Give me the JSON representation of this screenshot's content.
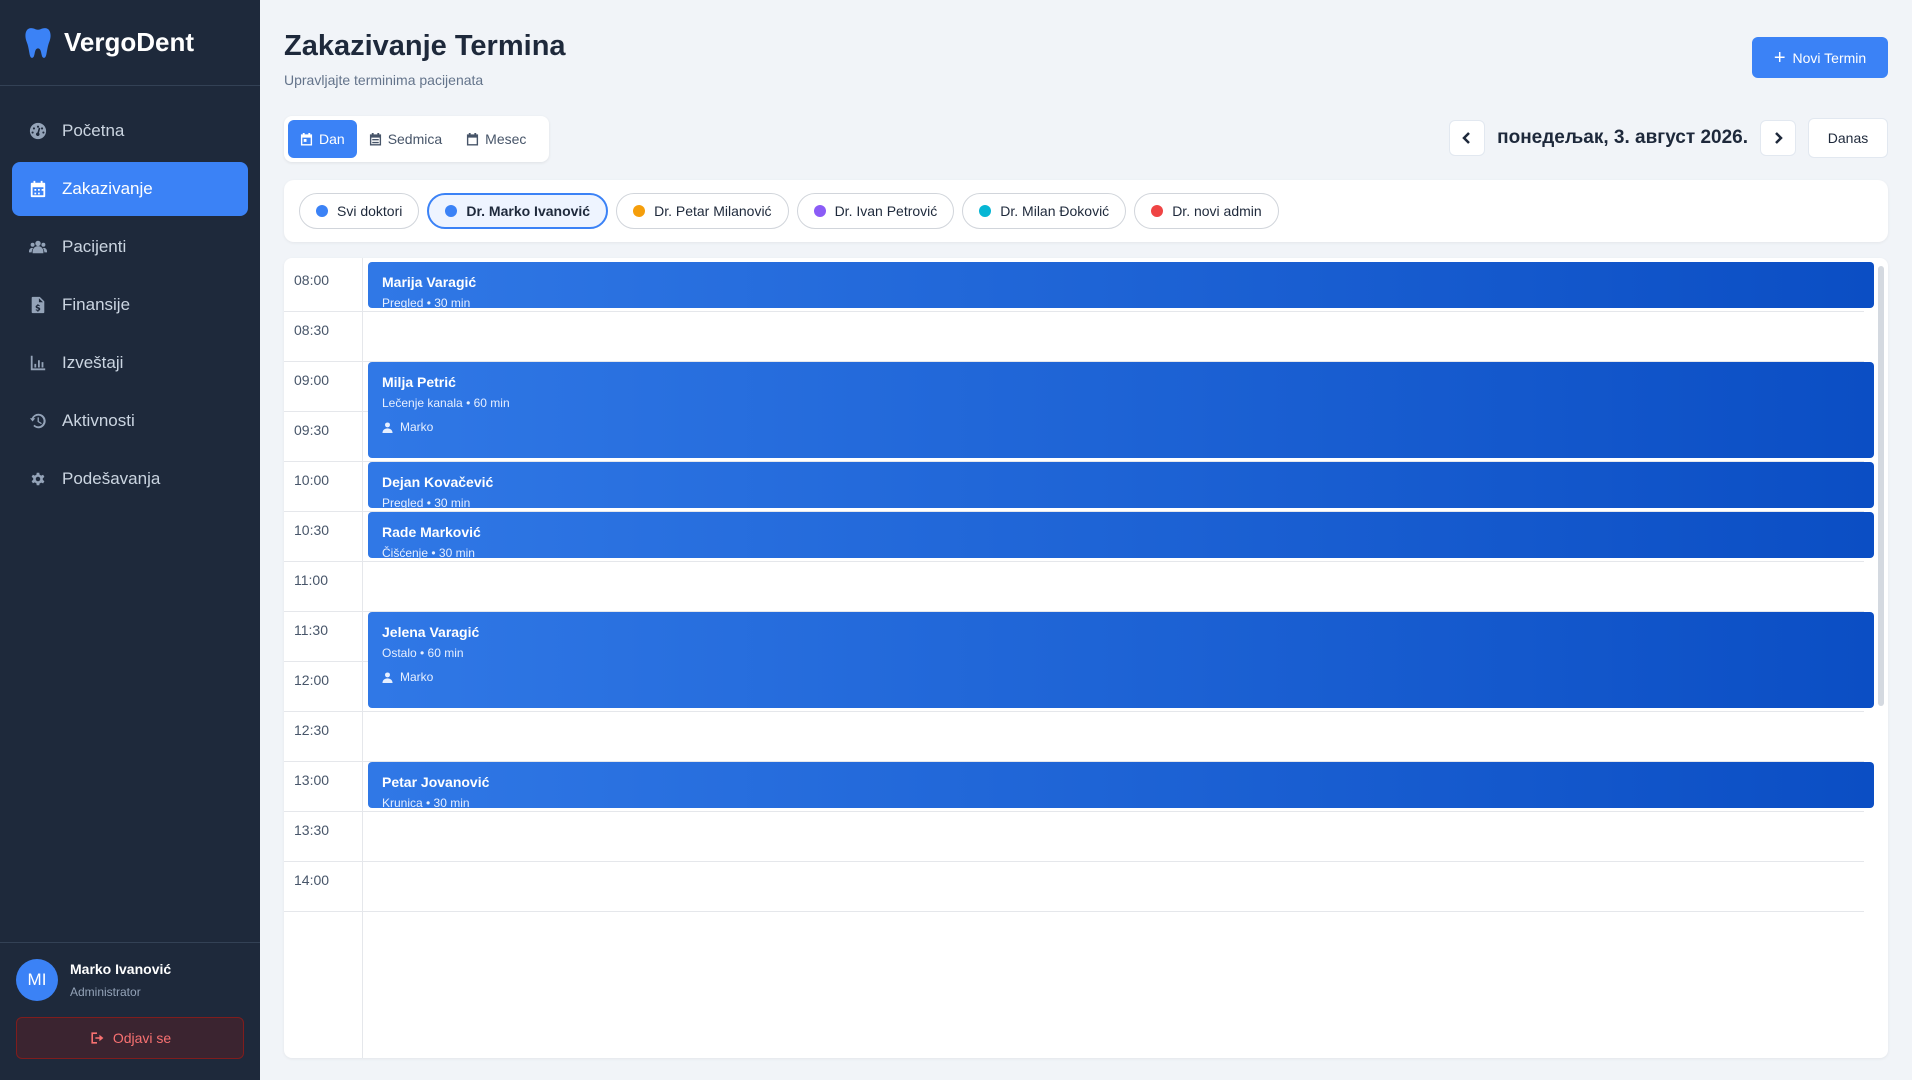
{
  "brand": {
    "name": "VergoDent"
  },
  "nav": [
    {
      "label": "Početna",
      "icon": "dashboard-icon"
    },
    {
      "label": "Zakazivanje",
      "icon": "calendar-icon",
      "active": true
    },
    {
      "label": "Pacijenti",
      "icon": "users-icon"
    },
    {
      "label": "Finansije",
      "icon": "invoice-icon"
    },
    {
      "label": "Izveštaji",
      "icon": "chart-icon"
    },
    {
      "label": "Aktivnosti",
      "icon": "history-icon"
    },
    {
      "label": "Podešavanja",
      "icon": "gear-icon"
    }
  ],
  "user": {
    "initials": "MI",
    "name": "Marko Ivanović",
    "role": "Administrator",
    "logout_label": "Odjavi se"
  },
  "header": {
    "title": "Zakazivanje Termina",
    "subtitle": "Upravljajte terminima pacijenata",
    "new_button": "Novi Termin"
  },
  "views": [
    {
      "label": "Dan",
      "active": true
    },
    {
      "label": "Sedmica"
    },
    {
      "label": "Mesec"
    }
  ],
  "date_nav": {
    "date": "понедељак, 3. август 2026.",
    "today": "Danas"
  },
  "doctors": [
    {
      "label": "Svi doktori",
      "color": "#3b82f6"
    },
    {
      "label": "Dr. Marko Ivanović",
      "color": "#3b82f6",
      "active": true
    },
    {
      "label": "Dr. Petar Milanović",
      "color": "#f59e0b"
    },
    {
      "label": "Dr. Ivan Petrović",
      "color": "#8b5cf6"
    },
    {
      "label": "Dr. Milan Đoković",
      "color": "#06b6d4"
    },
    {
      "label": "Dr. novi admin",
      "color": "#ef4444"
    }
  ],
  "times": [
    "08:00",
    "08:30",
    "09:00",
    "09:30",
    "10:00",
    "10:30",
    "11:00",
    "11:30",
    "12:00",
    "12:30",
    "13:00",
    "13:30",
    "14:00"
  ],
  "appointments": [
    {
      "patient": "Marija Varagić",
      "detail": "Pregled • 30 min",
      "start": "08:00",
      "duration_min": 30
    },
    {
      "patient": "Milja Petrić",
      "detail": "Lečenje kanala • 60 min",
      "doctor": "Marko",
      "start": "09:00",
      "duration_min": 60
    },
    {
      "patient": "Dejan Kovačević",
      "detail": "Pregled • 30 min",
      "start": "10:00",
      "duration_min": 30
    },
    {
      "patient": "Rade Marković",
      "detail": "Čišćenje • 30 min",
      "start": "10:30",
      "duration_min": 30
    },
    {
      "patient": "Jelena Varagić",
      "detail": "Ostalo • 60 min",
      "doctor": "Marko",
      "start": "11:30",
      "duration_min": 60
    },
    {
      "patient": "Petar Jovanović",
      "detail": "Krunica • 30 min",
      "start": "13:00",
      "duration_min": 30
    }
  ]
}
